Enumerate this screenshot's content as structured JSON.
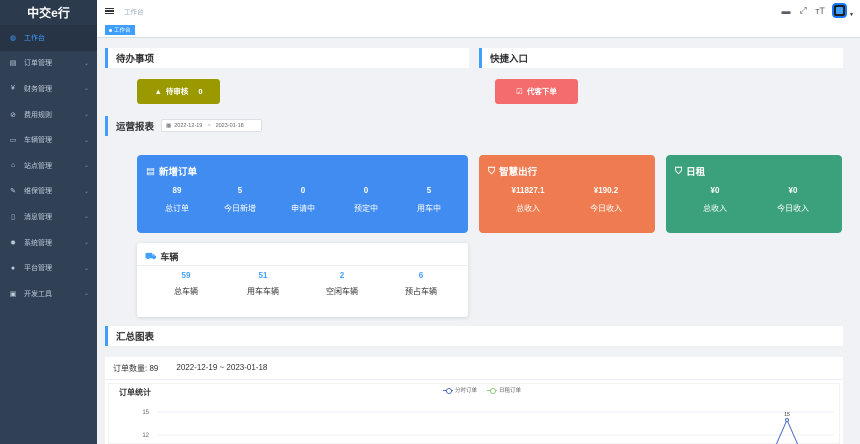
{
  "app": {
    "title": "中交e行"
  },
  "sidebar": {
    "items": [
      {
        "label": "工作台",
        "icon": "dashboard-icon",
        "glyph": "◍",
        "active": true,
        "has_children": false
      },
      {
        "label": "订单管理",
        "icon": "document-icon",
        "glyph": "▤",
        "has_children": true
      },
      {
        "label": "财务管理",
        "icon": "yen-icon",
        "glyph": "¥",
        "has_children": true
      },
      {
        "label": "费用规则",
        "icon": "rule-icon",
        "glyph": "⊘",
        "has_children": true
      },
      {
        "label": "车辆管理",
        "icon": "car-icon",
        "glyph": "▭",
        "has_children": true
      },
      {
        "label": "站点管理",
        "icon": "location-icon",
        "glyph": "⌂",
        "has_children": true
      },
      {
        "label": "维保管理",
        "icon": "wrench-icon",
        "glyph": "✎",
        "has_children": true
      },
      {
        "label": "消息管理",
        "icon": "phone-icon",
        "glyph": "▯",
        "has_children": true
      },
      {
        "label": "系统管理",
        "icon": "gear-icon",
        "glyph": "✹",
        "has_children": true
      },
      {
        "label": "平台管理",
        "icon": "user-icon",
        "glyph": "●",
        "has_children": true
      },
      {
        "label": "开发工具",
        "icon": "tool-icon",
        "glyph": "▣",
        "has_children": true
      }
    ]
  },
  "header": {
    "breadcrumb": "工作台",
    "icons": [
      {
        "name": "message-icon",
        "glyph": "▬"
      },
      {
        "name": "fullscreen-icon",
        "glyph": "⤢"
      },
      {
        "name": "font-size-icon",
        "glyph": "ᴛT"
      }
    ]
  },
  "tags": {
    "active_tag": "工作台"
  },
  "sections": {
    "todo": "待办事项",
    "shortcuts": "快捷入口",
    "report": "运营报表",
    "summary": "汇总图表"
  },
  "todo_button": {
    "label": "待审核",
    "count": "0",
    "color": "#9a9a00"
  },
  "shortcut_button": {
    "label": "代客下单",
    "color": "#f56c6c"
  },
  "daterange": {
    "start": "2022-12-19",
    "sep": "~",
    "end": "2023-01-18"
  },
  "cards": {
    "new_orders": {
      "title": "新增订单",
      "color": "#418cf0",
      "stats": [
        {
          "value": "89",
          "label": "总订单"
        },
        {
          "value": "5",
          "label": "今日新增"
        },
        {
          "value": "0",
          "label": "申请中"
        },
        {
          "value": "0",
          "label": "预定中"
        },
        {
          "value": "5",
          "label": "用车中"
        }
      ]
    },
    "smart_travel": {
      "title": "智慧出行",
      "color": "#ee7c50",
      "stats": [
        {
          "value": "¥11827.1",
          "label": "总收入"
        },
        {
          "value": "¥190.2",
          "label": "今日收入"
        }
      ]
    },
    "daily_rent": {
      "title": "日租",
      "color": "#3ba17c",
      "stats": [
        {
          "value": "¥0",
          "label": "总收入"
        },
        {
          "value": "¥0",
          "label": "今日收入"
        }
      ]
    },
    "vehicles": {
      "title": "车辆",
      "stats": [
        {
          "value": "59",
          "label": "总车辆"
        },
        {
          "value": "51",
          "label": "用车车辆"
        },
        {
          "value": "2",
          "label": "空闲车辆"
        },
        {
          "value": "6",
          "label": "预占车辆"
        }
      ]
    }
  },
  "summary": {
    "order_count_label": "订单数量:",
    "order_count": "89",
    "range": "2022-12-19 ~ 2023-01-18"
  },
  "chart_data": {
    "type": "line",
    "title": "订单统计",
    "series": [
      {
        "name": "分时订单",
        "color": "#5470c6"
      },
      {
        "name": "日租订单",
        "color": "#91cc75"
      }
    ],
    "y_ticks": [
      "15",
      "12"
    ],
    "visible_peak": "15"
  }
}
